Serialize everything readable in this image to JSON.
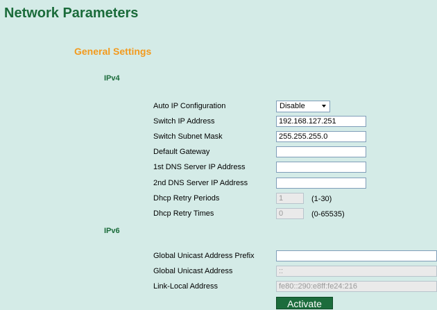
{
  "page": {
    "title": "Network Parameters"
  },
  "general": {
    "title": "General Settings"
  },
  "ipv4": {
    "title": "IPv4",
    "auto_ip": {
      "label": "Auto IP Configuration",
      "value": "Disable"
    },
    "switch_ip": {
      "label": "Switch IP Address",
      "value": "192.168.127.251"
    },
    "subnet": {
      "label": "Switch Subnet Mask",
      "value": "255.255.255.0"
    },
    "gateway": {
      "label": "Default Gateway",
      "value": ""
    },
    "dns1": {
      "label": "1st DNS Server IP Address",
      "value": ""
    },
    "dns2": {
      "label": "2nd DNS Server IP Address",
      "value": ""
    },
    "retry_periods": {
      "label": "Dhcp Retry Periods",
      "value": "1",
      "range": "(1-30)"
    },
    "retry_times": {
      "label": "Dhcp Retry Times",
      "value": "0",
      "range": "(0-65535)"
    }
  },
  "ipv6": {
    "title": "IPv6",
    "prefix": {
      "label": "Global Unicast Address Prefix",
      "value": ""
    },
    "global": {
      "label": "Global Unicast Address",
      "value": "::"
    },
    "link_local": {
      "label": "Link-Local Address",
      "value": "fe80::290:e8ff:fe24:216"
    }
  },
  "actions": {
    "activate": "Activate"
  }
}
